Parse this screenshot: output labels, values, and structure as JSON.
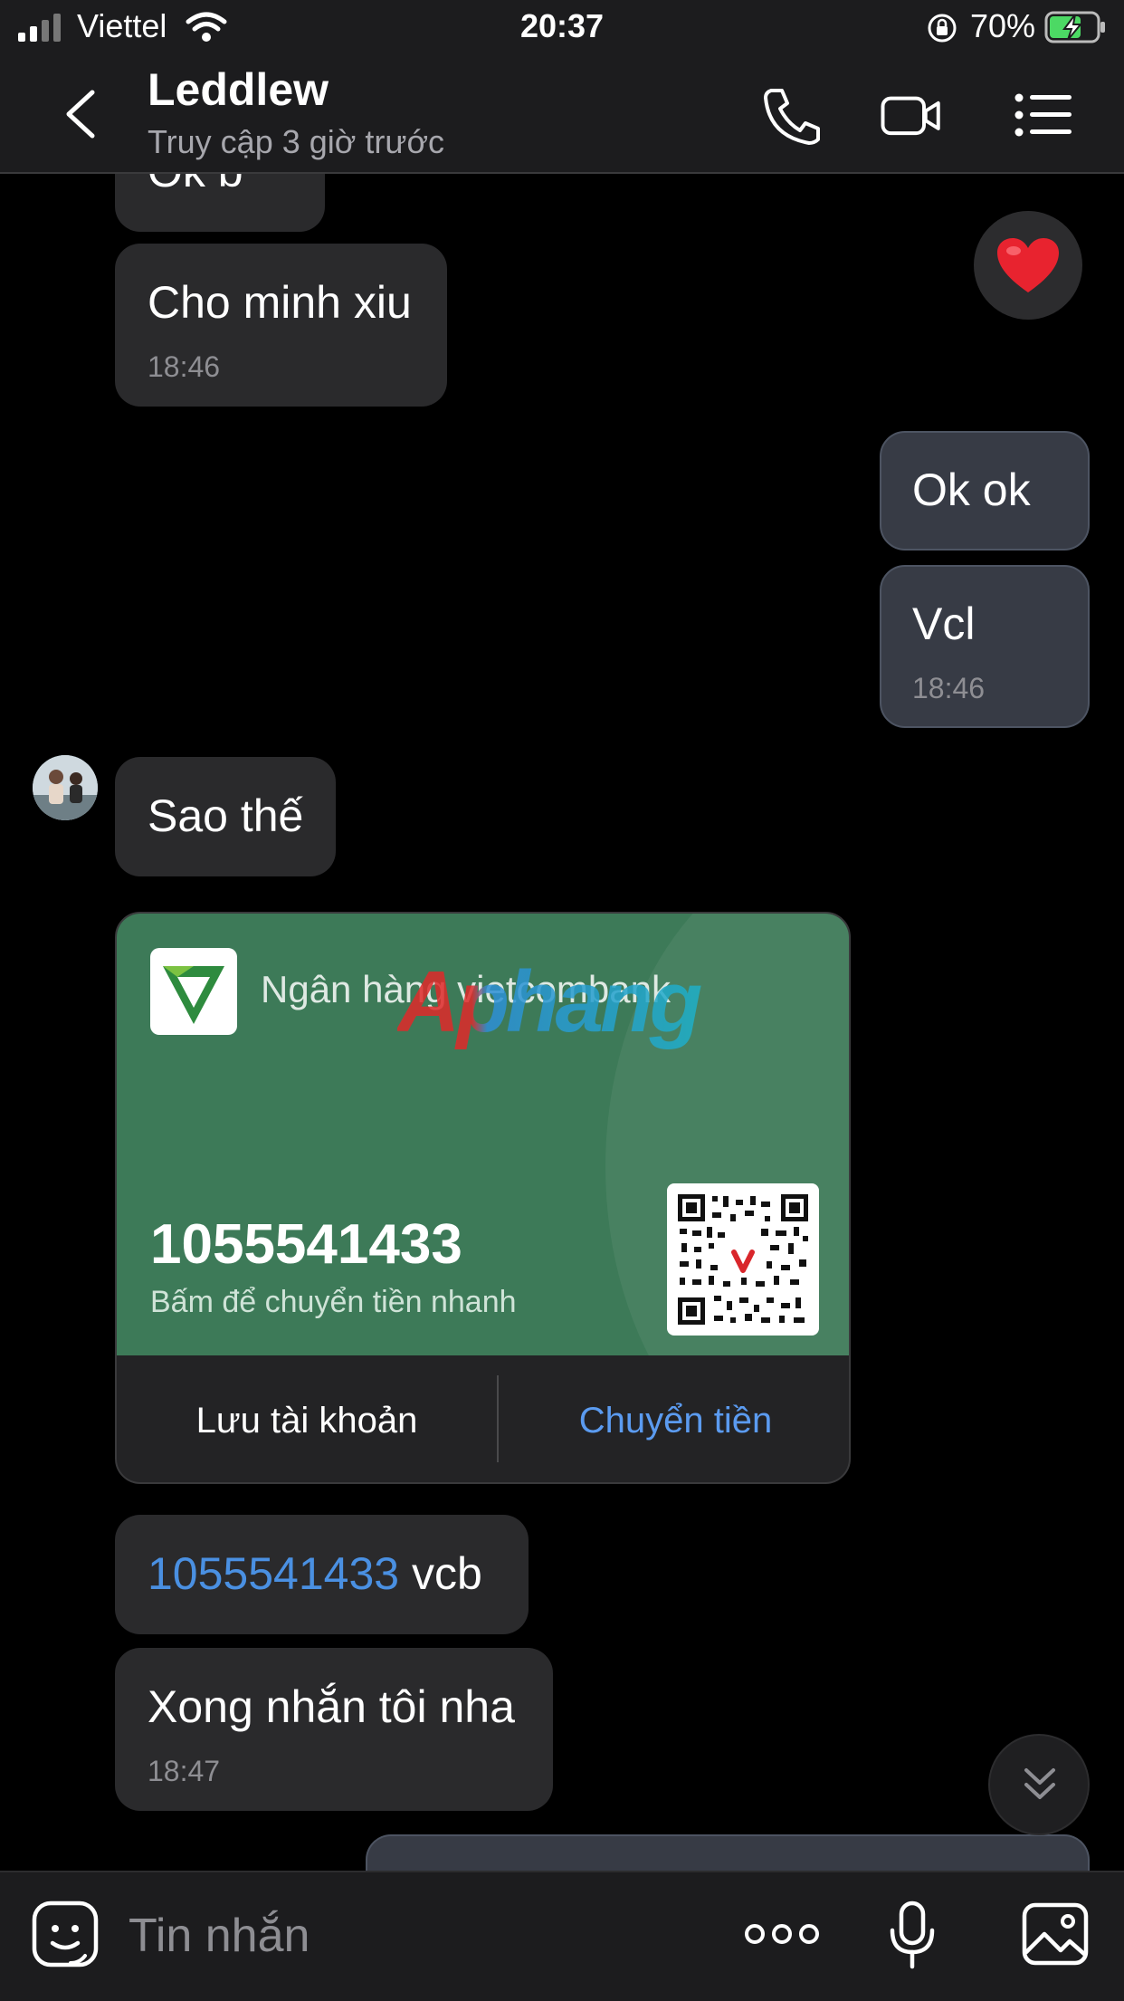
{
  "status_bar": {
    "carrier": "Viettel",
    "time": "20:37",
    "battery": "70%"
  },
  "header": {
    "title": "Leddlew",
    "subtitle": "Truy cập 3 giờ trước",
    "icons": [
      "back-chevron-icon",
      "phone-icon",
      "video-camera-icon",
      "menu-list-icon"
    ]
  },
  "messages": [
    {
      "id": "m0",
      "dir": "in",
      "text": "Ok b"
    },
    {
      "id": "m1",
      "dir": "in",
      "text": "Cho minh xiu",
      "time": "18:46"
    },
    {
      "id": "m2",
      "dir": "out",
      "text": "Ok ok"
    },
    {
      "id": "m3",
      "dir": "out",
      "text": "Vcl",
      "time": "18:46"
    },
    {
      "id": "m4",
      "dir": "in",
      "text": "Sao thế"
    },
    {
      "id": "m6",
      "dir": "in",
      "link": "1055541433",
      "text": " vcb"
    },
    {
      "id": "m7",
      "dir": "in",
      "text": "Xong nhắn tôi nha",
      "time": "18:47"
    }
  ],
  "reaction": {
    "emoji": "❤️",
    "icon": "heart-reaction-icon"
  },
  "bank_card": {
    "bank_name": "Ngân hàng vietcombank",
    "watermark": "Aphang",
    "account_number": "1055541433",
    "subtitle": "Bấm để chuyển tiền nhanh",
    "save_label": "Lưu tài khoản",
    "transfer_label": "Chuyển tiền",
    "colors": {
      "card": "#3d7a58",
      "link": "#5b9bf0"
    }
  },
  "input": {
    "placeholder": "Tin nhắn"
  },
  "colors": {
    "bubble_in": "#2a2a2c",
    "bubble_out": "#373b45",
    "link": "#4a90e2",
    "background": "#000000"
  }
}
